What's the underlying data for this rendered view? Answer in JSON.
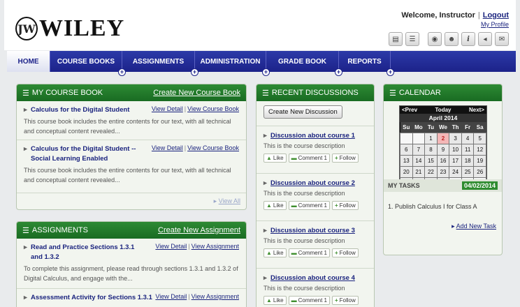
{
  "brand": {
    "name": "WILEY"
  },
  "user": {
    "welcome": "Welcome, Instructor",
    "logout": "Logout",
    "profile": "My Profile"
  },
  "toolbar_icons": [
    "print-icon",
    "document-icon",
    "chat-icon",
    "group-icon",
    "info-icon",
    "sound-icon",
    "mail-icon"
  ],
  "nav": [
    "HOME",
    "COURSE BOOKS",
    "ASSIGNMENTS",
    "ADMINISTRATION",
    "GRADE BOOK",
    "REPORTS"
  ],
  "course_book": {
    "title": "MY COURSE BOOK",
    "action": "Create New Course Book",
    "view_detail": "View Detail",
    "view_course_book": "View Course Book",
    "items": [
      {
        "title": "Calculus for the Digital Student",
        "desc": "This course book includes the entire contents for our text, with all technical and conceptual content revealed..."
      },
      {
        "title": "Calculus for the Digital Student -- Social Learning Enabled",
        "desc": "This course book includes the entire contents for our text, with all technical and conceptual content revealed..."
      }
    ],
    "view_all": "View All"
  },
  "assignments": {
    "title": "ASSIGNMENTS",
    "action": "Create New Assignment",
    "view_detail": "View Detail",
    "view_assignment": "View Assignment",
    "items": [
      {
        "title": "Read and Practice Sections 1.3.1 and 1.3.2",
        "desc": "To complete this assignment, please read through sections 1.3.1 and 1.3.2 of Digital Calculus, and engage with the..."
      },
      {
        "title": "Assessment Activity for Sections 1.3.1",
        "desc": ""
      }
    ]
  },
  "discussions": {
    "title": "RECENT DISCUSSIONS",
    "create": "Create New Discussion",
    "like": "Like",
    "comment": "Comment 1",
    "follow": "Follow",
    "items": [
      {
        "title": "Discussion about course 1",
        "desc": "This is the course description"
      },
      {
        "title": "Discussion about course 2",
        "desc": "This is the course description"
      },
      {
        "title": "Discussion about course 3",
        "desc": "This is the course description"
      },
      {
        "title": "Discussion about course 4",
        "desc": "This is the course description"
      }
    ]
  },
  "calendar": {
    "title": "CALENDAR",
    "prev": "<Prev",
    "today": "Today",
    "next": "Next>",
    "month": "April 2014",
    "days": [
      "Su",
      "Mo",
      "Tu",
      "We",
      "Th",
      "Fr",
      "Sa"
    ],
    "weeks": [
      [
        "",
        "",
        "1",
        "2",
        "3",
        "4",
        "5"
      ],
      [
        "6",
        "7",
        "8",
        "9",
        "10",
        "11",
        "12"
      ],
      [
        "13",
        "14",
        "15",
        "16",
        "17",
        "18",
        "19"
      ],
      [
        "20",
        "21",
        "22",
        "23",
        "24",
        "25",
        "26"
      ],
      [
        "27",
        "28",
        "29",
        "30",
        "",
        "",
        ""
      ]
    ],
    "highlighted": "2"
  },
  "tasks": {
    "title": "MY TASKS",
    "date": "04/02/2014",
    "items": [
      "1. Publish Calculus I for Class A"
    ],
    "add": "Add New Task"
  },
  "colors": {
    "nav": "#1c228a",
    "panel_header": "#196b22",
    "link": "#1a237e"
  }
}
